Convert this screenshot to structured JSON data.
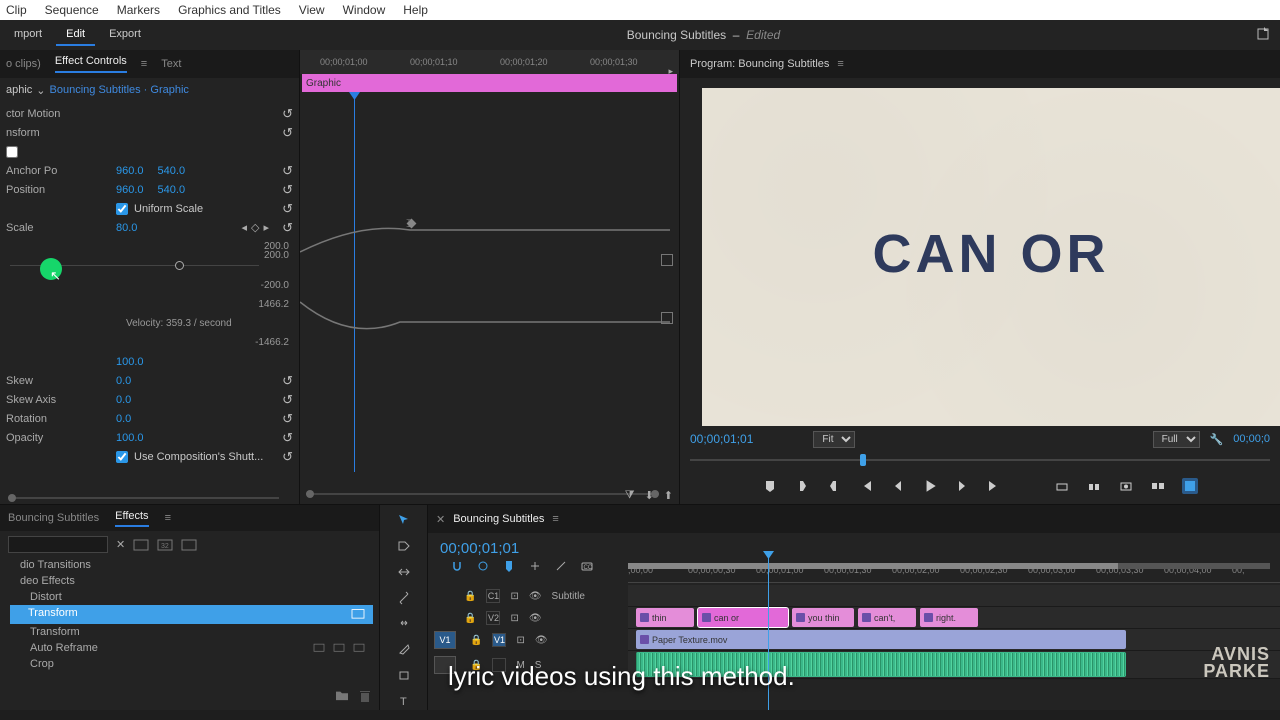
{
  "menubar": [
    "Clip",
    "Sequence",
    "Markers",
    "Graphics and Titles",
    "View",
    "Window",
    "Help"
  ],
  "modes": {
    "import": "mport",
    "edit": "Edit",
    "export": "Export"
  },
  "project": {
    "name": "Bouncing Subtitles",
    "state": "Edited"
  },
  "tabs": {
    "noclips": "o clips)",
    "ec": "Effect Controls",
    "text": "Text"
  },
  "ec": {
    "source_label": "aphic",
    "clip_link": "Bouncing Subtitles · Graphic",
    "times": [
      "00;00;01;00",
      "00;00;01;10",
      "00;00;01;20",
      "00;00;01;30"
    ],
    "clip_label": "Graphic",
    "rows": {
      "motion": "ctor Motion",
      "transform": "nsform",
      "anchor": "Anchor Po",
      "anchor_x": "960.0",
      "anchor_y": "540.0",
      "position": "Position",
      "pos_x": "960.0",
      "pos_y": "540.0",
      "uniform": "Uniform Scale",
      "scale": "Scale",
      "scale_v": "80.0",
      "v200a": "200.0",
      "v200b": "200.0",
      "vneg200": "-200.0",
      "v1466": "1466.2",
      "vneg1466": "-1466.2",
      "velocity": "Velocity: 359.3 / second",
      "v100": "100.0",
      "skew": "Skew",
      "skew_v": "0.0",
      "skewaxis": "Skew Axis",
      "skewaxis_v": "0.0",
      "rotation": "Rotation",
      "rotation_v": "0.0",
      "opacity": "Opacity",
      "opacity_v": "100.0",
      "shutter": "Use Composition's Shutt..."
    }
  },
  "program": {
    "label": "Program: Bouncing Subtitles",
    "text": "CAN OR",
    "tc": "00;00;01;01",
    "fit": "Fit",
    "full": "Full",
    "tc2": "00;00;0"
  },
  "effects_panel": {
    "proj": "Bouncing Subtitles",
    "fx": "Effects",
    "tree": [
      "dio Transitions",
      "deo Effects",
      "Distort",
      "Transform",
      "Transform",
      "Auto Reframe",
      "Crop"
    ]
  },
  "timeline": {
    "name": "Bouncing Subtitles",
    "tc": "00;00;01;01",
    "ruler": [
      ";00;00",
      "00;00;00;30",
      "00;00;01;00",
      "00;00;01;30",
      "00;00;02;00",
      "00;00;02;30",
      "00;00;03;00",
      "00;00;03;30",
      "00;00;04;00",
      "00;"
    ],
    "track_c1": "C1",
    "track_sub": "Subtitle",
    "track_v2": "V2",
    "track_v1": "V1",
    "src_v1": "V1",
    "clips": {
      "thin": "thin",
      "canor": "can or",
      "youthin": "you thin",
      "cant": "can't,",
      "right": "right.",
      "paper": "Paper Texture.mov"
    }
  },
  "caption": "lyric videos using this method.",
  "watermark": {
    "l1": "AVNIS",
    "l2": "PARKE"
  }
}
